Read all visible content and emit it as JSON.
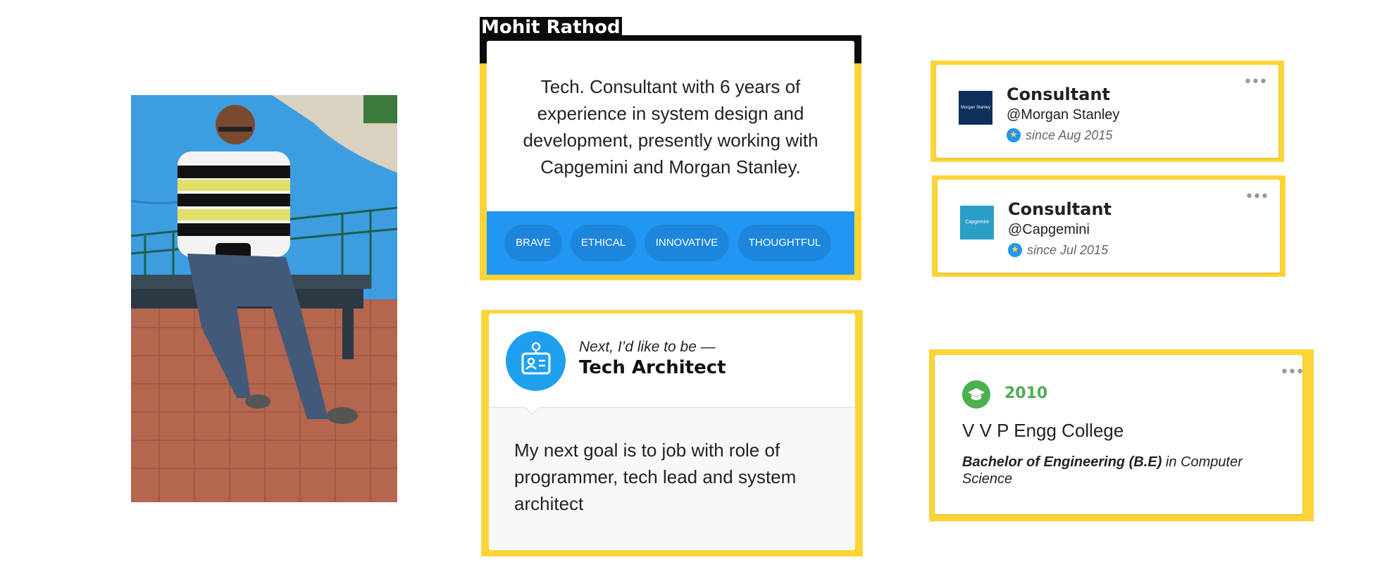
{
  "profile": {
    "name": "Mohit Rathod",
    "bio": "Tech. Consultant with 6 years of experience in system design and development, presently working with Capgemini and Morgan Stanley.",
    "traits": [
      "BRAVE",
      "ETHICAL",
      "INNOVATIVE",
      "THOUGHTFUL"
    ]
  },
  "goal": {
    "kicker": "Next, I’d like to be —",
    "title": "Tech Architect",
    "text": "My next goal is to job with role of programmer, tech lead and system architect",
    "icon": "id-badge-icon"
  },
  "jobs": [
    {
      "title": "Consultant",
      "company": "@Morgan Stanley",
      "since": "since Aug 2015",
      "logo_text": "Morgan Stanley",
      "logo_color": "#0d2f5c"
    },
    {
      "title": "Consultant",
      "company": "@Capgemini",
      "since": "since Jul 2015",
      "logo_text": "Capgemini",
      "logo_color": "#2b9ec8"
    }
  ],
  "education": {
    "year": "2010",
    "school": "V V P Engg College",
    "degree": "Bachelor of Engineering (B.E)",
    "field_prefix": "in",
    "field": "Computer Science",
    "icon": "graduation-cap-icon"
  },
  "colors": {
    "frame_yellow": "#fbd537",
    "trait_blue": "#2196f3",
    "goal_icon_blue": "#1ea0ef",
    "edu_green": "#4caf50"
  }
}
